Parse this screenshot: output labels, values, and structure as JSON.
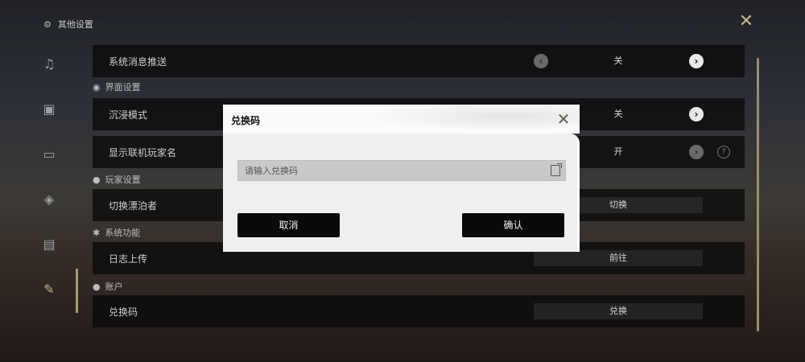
{
  "header": {
    "title": "其他设置"
  },
  "sidebar": {
    "items": [
      {
        "icon": "music-icon"
      },
      {
        "icon": "display-icon"
      },
      {
        "icon": "monitor-icon"
      },
      {
        "icon": "gamepad-icon"
      },
      {
        "icon": "keyboard-icon"
      },
      {
        "icon": "tools-icon"
      }
    ]
  },
  "settings": {
    "system_push": {
      "label": "系统消息推送",
      "value": "关"
    },
    "section_ui": "界面设置",
    "immersive": {
      "label": "沉浸模式",
      "value": "关"
    },
    "show_names": {
      "label": "显示联机玩家名",
      "value": "开",
      "help": "?"
    },
    "section_player": "玩家设置",
    "switch_wanderer": {
      "label": "切换漂泊者",
      "value": "切换"
    },
    "section_system": "系统功能",
    "log_upload": {
      "label": "日志上传",
      "value": "前往"
    },
    "section_account": "账户",
    "redeem": {
      "label": "兑换码",
      "value": "兑换"
    }
  },
  "dialog": {
    "title": "兑换码",
    "input_placeholder": "请输入兑换码",
    "cancel_label": "取消",
    "confirm_label": "确认"
  }
}
